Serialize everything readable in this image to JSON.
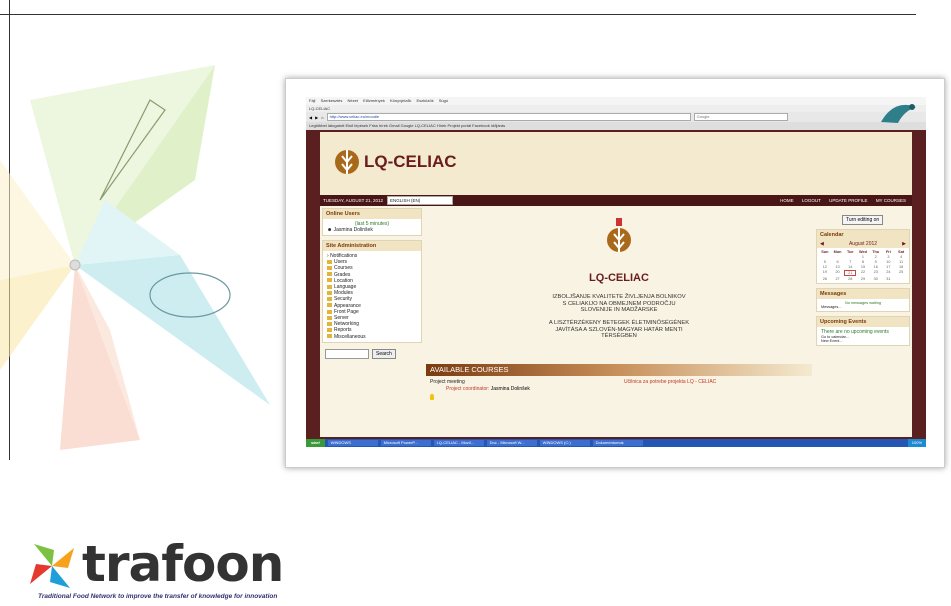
{
  "browser": {
    "menu": [
      "Fájl",
      "Szerkesztés",
      "Nézet",
      "Előzmények",
      "Könyvjelzők",
      "Eszközök",
      "Súgó"
    ],
    "tab": "LQ-CELIAC",
    "url": "http://www.celiac.eu/moodle",
    "search_placeholder": "Google",
    "bookmarks": "Legtöbbet látogatott   Első lépések   Friss hírek   Gmail   Google   LQ-CELIAC   Hírek   Projekt portál   Facebook   Időjárás"
  },
  "site": {
    "title": "LQ-CELIAC",
    "date": "TUESDAY, AUGUST 21, 2012",
    "language": "ENGLISH (EN)",
    "nav": [
      "HOME",
      "LOGOUT",
      "UPDATE PROFILE",
      "MY COURSES"
    ]
  },
  "online_users": {
    "heading": "Online Users",
    "note": "(last 5 minutes)",
    "user": "Jasmina Dolinšek"
  },
  "site_admin": {
    "heading": "Site Administration",
    "items": [
      "Notifications",
      "Users",
      "Courses",
      "Grades",
      "Location",
      "Language",
      "Modules",
      "Security",
      "Appearance",
      "Front Page",
      "Server",
      "Networking",
      "Reports",
      "Miscellaneous"
    ],
    "search_button": "Search"
  },
  "center": {
    "title": "LQ-CELIAC",
    "sl_text": [
      "IZBOLJŠANJE KVALITETE ŽIVLJENJA BOLNIKOV",
      "S CELIAKIJO NA OBMEJNEM PODROČJU",
      "SLOVENIJE IN MADŽARSKE"
    ],
    "hu_text": [
      "A LISZTÉRZÉKENY BETEGEK ÉLETMINŐSÉGÉNEK",
      "JAVÍTÁSA A SZLOVÉN-MAGYAR HATÁR MENTI",
      "TÉRSÉGBEN"
    ],
    "courses_heading": "AVAILABLE COURSES",
    "course_name": "Project meeting",
    "course_link": "Učilnica za potrebe projekta LQ - CELIAC",
    "coordinator_label": "Project coordinator:",
    "coordinator_name": "Jasmina Dolinšek"
  },
  "right": {
    "turn_editing": "Turn editing on",
    "calendar_heading": "Calendar",
    "month": "August 2012",
    "weekdays": [
      "Sun",
      "Mon",
      "Tue",
      "Wed",
      "Thu",
      "Fri",
      "Sat"
    ],
    "messages_heading": "Messages",
    "messages_note": "No messages waiting",
    "messages_link": "Messages...",
    "events_heading": "Upcoming Events",
    "events_note": "There are no upcoming events",
    "events_links": [
      "Go to calendar...",
      "New Event..."
    ]
  },
  "taskbar": {
    "start": "start",
    "tasks": [
      "WINDOWS",
      "Microsoft PowerP...",
      "LQ-CELIAC - Mozil...",
      "Doc - Microsoft W...",
      "WINDOWS (C:)",
      "Dokumentumok"
    ],
    "zoom": "100%"
  },
  "logo": {
    "word": "trafoon",
    "tagline": "Traditional Food Network to improve the transfer of knowledge for innovation"
  }
}
